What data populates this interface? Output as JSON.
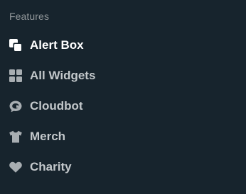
{
  "sidebar": {
    "section_title": "Features",
    "items": [
      {
        "label": "Alert Box",
        "icon": "alert-box-icon",
        "active": true
      },
      {
        "label": "All Widgets",
        "icon": "widgets-grid-icon",
        "active": false
      },
      {
        "label": "Cloudbot",
        "icon": "cloudbot-icon",
        "active": false
      },
      {
        "label": "Merch",
        "icon": "tshirt-icon",
        "active": false
      },
      {
        "label": "Charity",
        "icon": "heart-icon",
        "active": false
      }
    ]
  },
  "colors": {
    "background": "#17242d",
    "section_title": "#91979a",
    "item_label": "#c3c8cb",
    "active_label": "#ffffff",
    "icon": "#a8aeb2",
    "active_icon": "#ffffff"
  }
}
